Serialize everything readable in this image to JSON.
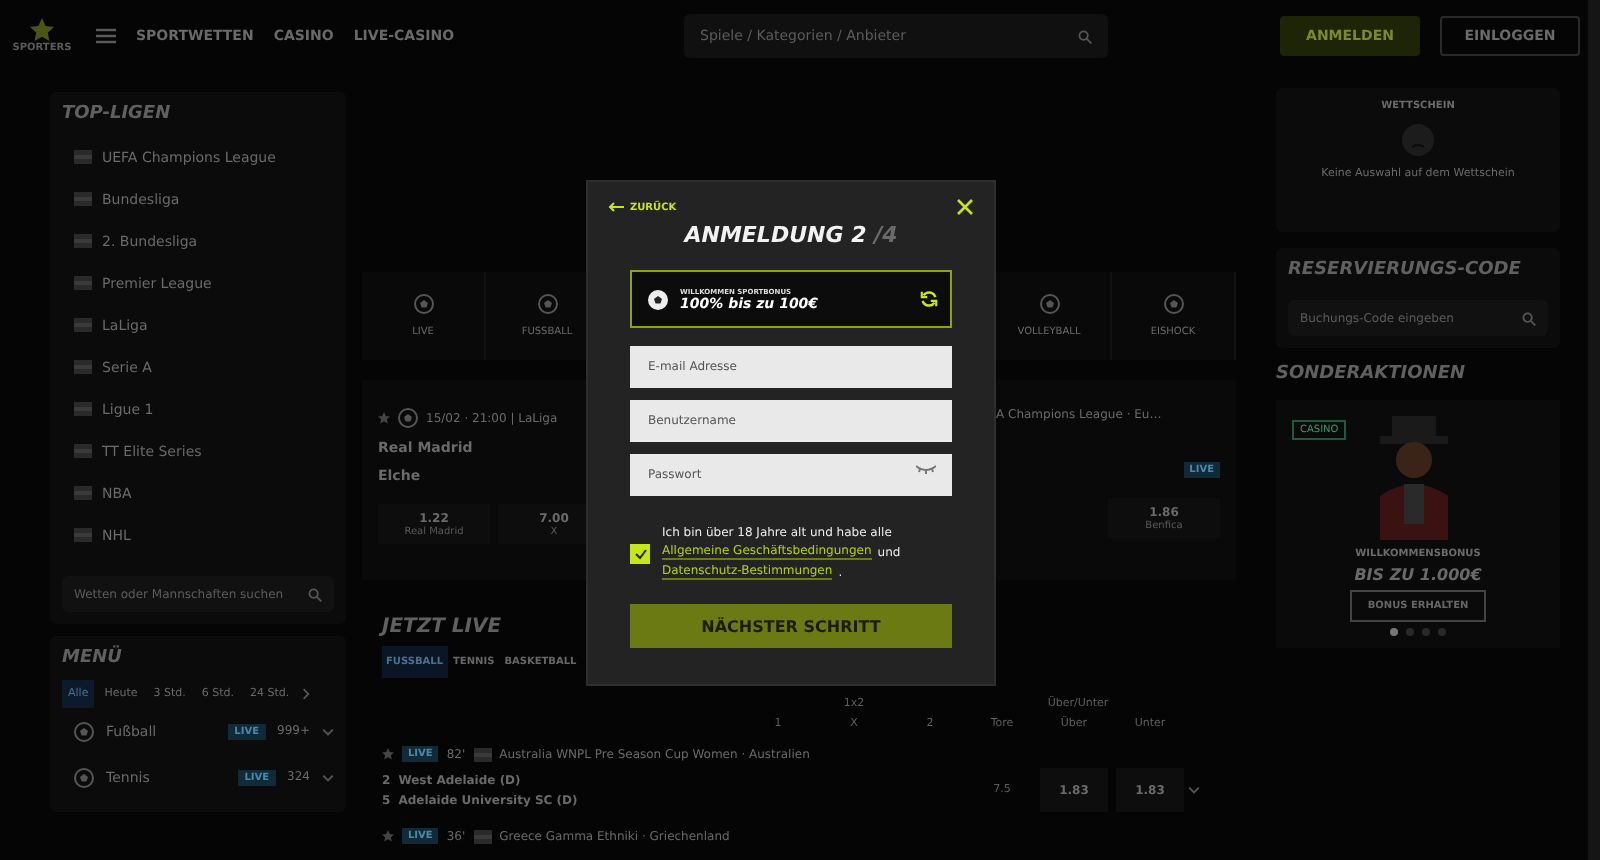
{
  "header": {
    "logo": "SPORTERS",
    "nav": [
      "SPORTWETTEN",
      "CASINO",
      "LIVE-CASINO"
    ],
    "search": {
      "placeholder": "Spiele / Kategorien / Anbieter"
    },
    "buttons": [
      "ANMELDEN",
      "EINLOGGEN"
    ]
  },
  "top_leagues": {
    "title": "TOP-LIGEN",
    "items": [
      "UEFA Champions League",
      "Bundesliga",
      "2. Bundesliga",
      "Premier League",
      "LaLiga",
      "Serie A",
      "Ligue 1",
      "TT Elite Series",
      "NBA",
      "NHL"
    ],
    "search": {
      "placeholder": "Wetten oder Mannschaften suchen"
    }
  },
  "menu": {
    "title": "MENÜ",
    "filters": [
      {
        "label": "Alle",
        "selected": true
      },
      {
        "label": "Heute",
        "selected": false
      },
      {
        "label": "3 Std.",
        "selected": false
      },
      {
        "label": "6 Std.",
        "selected": false
      },
      {
        "label": "24 Std.",
        "selected": false
      }
    ],
    "sports": [
      {
        "name": "Fußball",
        "badge": "LIVE",
        "count": "999+"
      },
      {
        "name": "Tennis",
        "badge": "LIVE",
        "count": "324"
      }
    ]
  },
  "sport_nav": {
    "left": [
      "LIVE",
      "FUSSBALL"
    ],
    "right": [
      "VOLLEYBALL",
      "EISHOCK"
    ]
  },
  "featured": [
    {
      "meta": "15/02 · 21:00 | LaLiga",
      "home": "Real Madrid",
      "away": "Elche",
      "odds": [
        {
          "value": "1.22",
          "label": "Real Madrid"
        },
        {
          "value": "7.00",
          "label": "X"
        }
      ]
    },
    {
      "meta": "A Champions League · Eu…",
      "badge": "LIVE",
      "odds": [
        {
          "value": "1.86",
          "label": "Benfica"
        }
      ]
    }
  ],
  "live": {
    "title": "JETZT LIVE",
    "tabs": [
      {
        "label": "FUSSBALL",
        "selected": true
      },
      {
        "label": "TENNIS",
        "selected": false
      },
      {
        "label": "BASKETBALL",
        "selected": false
      }
    ],
    "groups": [
      "1x2",
      "Über/Unter"
    ],
    "columns": [
      "1",
      "X",
      "2",
      "Tore",
      "Über",
      "Unter"
    ],
    "matches": [
      {
        "badge": "LIVE",
        "minute": "82'",
        "league": "Australia WNPL Pre Season Cup Women · Australien",
        "teams": [
          {
            "score": "2",
            "name": "West Adelaide (D)"
          },
          {
            "score": "5",
            "name": "Adelaide University SC (D)"
          }
        ],
        "goals": "7.5",
        "odds": [
          "1.83",
          "1.83"
        ]
      },
      {
        "badge": "LIVE",
        "minute": "36'",
        "league": "Greece Gamma Ethniki · Griechenland"
      }
    ]
  },
  "betslip": {
    "title": "WETTSCHEIN",
    "message": "Keine Auswahl auf dem Wettschein"
  },
  "reservation": {
    "title": "RESERVIERUNGS-CODE",
    "placeholder": "Buchungs-Code eingeben"
  },
  "promotions": {
    "title": "SONDERAKTIONEN",
    "tag": "CASINO",
    "subtitle": "WILLKOMMENSBONUS",
    "headline": "BIS ZU 1.000€",
    "button": "BONUS ERHALTEN",
    "dots": [
      {
        "selected": true
      },
      {
        "selected": false
      },
      {
        "selected": false
      },
      {
        "selected": false
      }
    ]
  },
  "modal": {
    "back": "ZURÜCK",
    "title": "ANMELDUNG 2",
    "step_total": "/4",
    "bonus": {
      "label": "WILLKOMMEN SPORTBONUS",
      "value": "100% bis zu 100€"
    },
    "fields": [
      {
        "placeholder": "E-mail Adresse",
        "kind": "text"
      },
      {
        "placeholder": "Benutzername",
        "kind": "text"
      },
      {
        "placeholder": "Passwort",
        "kind": "password"
      }
    ],
    "consent": {
      "checked": true,
      "text": "Ich bin über 18 Jahre alt und habe alle",
      "link1": "Allgemeine Geschäftsbedingungen",
      "and": "und",
      "link2": "Datenschutz-Bestimmungen",
      "end": "."
    },
    "submit": "NÄCHSTER SCHRITT"
  }
}
